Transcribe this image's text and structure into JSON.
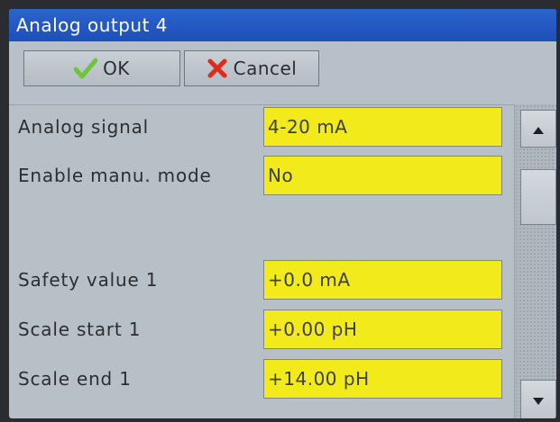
{
  "window": {
    "title": "Analog output 4"
  },
  "toolbar": {
    "ok_label": "OK",
    "cancel_label": "Cancel"
  },
  "settings": [
    {
      "label": "Analog signal",
      "value": "4-20 mA"
    },
    {
      "label": "Enable manu. mode",
      "value": "No"
    },
    {
      "label": "Safety value 1",
      "value": "+0.0 mA"
    },
    {
      "label": "Scale start 1",
      "value": "+0.00 pH"
    },
    {
      "label": "Scale end 1",
      "value": "+14.00 pH"
    }
  ],
  "icons": {
    "ok": "checkmark-icon",
    "cancel": "x-icon",
    "scroll_up": "triangle-up-icon",
    "scroll_down": "triangle-down-icon"
  },
  "colors": {
    "title_bar": "#1f4fb8",
    "field_background": "#f2ea1a",
    "panel_background": "#b8c0c7",
    "ok_icon": "#6fc53a",
    "cancel_icon": "#e02a1c"
  }
}
